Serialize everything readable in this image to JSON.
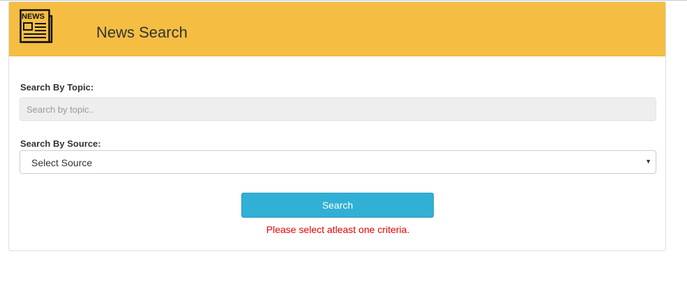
{
  "header": {
    "title": "News Search",
    "icon": "newspaper-icon",
    "icon_text": "NEWS",
    "background_color": "#f5be42"
  },
  "topic": {
    "label": "Search By Topic:",
    "placeholder": "Search by topic..",
    "value": ""
  },
  "source": {
    "label": "Search By Source:",
    "selected": "Select Source"
  },
  "search_button": {
    "label": "Search",
    "color": "#31b0d5"
  },
  "error": {
    "message": "Please select atleast one criteria.",
    "color": "#e50000"
  }
}
